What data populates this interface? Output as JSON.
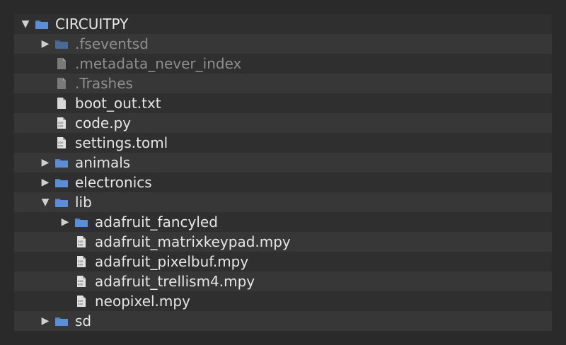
{
  "tree": {
    "rows": [
      {
        "name": "CIRCUITPY",
        "kind": "folder",
        "depth": 0,
        "state": "expanded",
        "dim": false,
        "icon": "folder-icon"
      },
      {
        "name": ".fseventsd",
        "kind": "folder",
        "depth": 1,
        "state": "collapsed",
        "dim": true,
        "icon": "folder-icon"
      },
      {
        "name": ".metadata_never_index",
        "kind": "file",
        "depth": 1,
        "state": "none",
        "dim": true,
        "icon": "file-icon"
      },
      {
        "name": ".Trashes",
        "kind": "file",
        "depth": 1,
        "state": "none",
        "dim": true,
        "icon": "file-icon"
      },
      {
        "name": "boot_out.txt",
        "kind": "file",
        "depth": 1,
        "state": "none",
        "dim": false,
        "icon": "file-icon"
      },
      {
        "name": "code.py",
        "kind": "code",
        "depth": 1,
        "state": "none",
        "dim": false,
        "icon": "code-file-icon"
      },
      {
        "name": "settings.toml",
        "kind": "code",
        "depth": 1,
        "state": "none",
        "dim": false,
        "icon": "code-file-icon"
      },
      {
        "name": "animals",
        "kind": "folder",
        "depth": 1,
        "state": "collapsed",
        "dim": false,
        "icon": "folder-icon"
      },
      {
        "name": "electronics",
        "kind": "folder",
        "depth": 1,
        "state": "collapsed",
        "dim": false,
        "icon": "folder-icon"
      },
      {
        "name": "lib",
        "kind": "folder",
        "depth": 1,
        "state": "expanded",
        "dim": false,
        "icon": "folder-icon"
      },
      {
        "name": "adafruit_fancyled",
        "kind": "folder",
        "depth": 2,
        "state": "collapsed",
        "dim": false,
        "icon": "folder-icon"
      },
      {
        "name": "adafruit_matrixkeypad.mpy",
        "kind": "code",
        "depth": 2,
        "state": "none",
        "dim": false,
        "icon": "code-file-icon"
      },
      {
        "name": "adafruit_pixelbuf.mpy",
        "kind": "code",
        "depth": 2,
        "state": "none",
        "dim": false,
        "icon": "code-file-icon"
      },
      {
        "name": "adafruit_trellism4.mpy",
        "kind": "code",
        "depth": 2,
        "state": "none",
        "dim": false,
        "icon": "code-file-icon"
      },
      {
        "name": "neopixel.mpy",
        "kind": "code",
        "depth": 2,
        "state": "none",
        "dim": false,
        "icon": "code-file-icon"
      },
      {
        "name": "sd",
        "kind": "folder",
        "depth": 1,
        "state": "collapsed",
        "dim": false,
        "icon": "folder-icon"
      }
    ]
  },
  "colors": {
    "background": "#2a2a2a",
    "row": "#2f2f2f",
    "row_alt": "#373737",
    "text": "#e6e6e6",
    "text_dim": "#8e8e8e",
    "folder": "#5b8ed6",
    "file": "#d8d8d8"
  }
}
